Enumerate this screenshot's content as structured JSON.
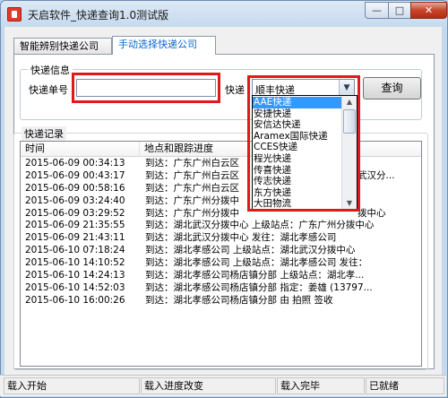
{
  "window": {
    "title": "天启软件_快递查询1.0测试版",
    "controls": {
      "minimize": "—",
      "maximize": "□",
      "close": "✕"
    }
  },
  "tabs": [
    {
      "label": "智能辨别快递公司"
    },
    {
      "label": "手动选择快递公司"
    }
  ],
  "query_group": {
    "title": "快递信息",
    "tracking_label": "快递单号",
    "tracking_value": "",
    "courier_label": "快递",
    "courier_selected": "顺丰快递",
    "query_button": "查询",
    "courier_options": [
      "AAE快递",
      "安捷快递",
      "安信达快递",
      "Aramex国际快递",
      "CCES快递",
      "程光快递",
      "传喜快递",
      "传志快递",
      "东方快递",
      "大田物流"
    ],
    "selected_option_index": 0
  },
  "records": {
    "title": "快递记录",
    "columns": [
      "时间",
      "地点和跟踪进度"
    ],
    "rows": [
      {
        "time": "2015-06-09 00:34:13",
        "status": "到达：广东广州白云区"
      },
      {
        "time": "2015-06-09 00:43:17",
        "status": "到达：广东广州白云区",
        "status_tail": "武汉分..."
      },
      {
        "time": "2015-06-09 00:58:16",
        "status": "到达：广东广州白云区"
      },
      {
        "time": "2015-06-09 03:24:40",
        "status": "到达：广东广州分拨中"
      },
      {
        "time": "2015-06-09 03:29:52",
        "status": "到达：广东广州分拨中",
        "status_tail": "拨中心"
      },
      {
        "time": "2015-06-09 21:35:55",
        "status": "到达：湖北武汉分拨中心 上级站点：广东广州分拨中心"
      },
      {
        "time": "2015-06-09 21:43:11",
        "status": "到达：湖北武汉分拨中心 发往：湖北孝感公司"
      },
      {
        "time": "2015-06-10 07:18:24",
        "status": "到达：湖北孝感公司 上级站点：湖北武汉分拨中心"
      },
      {
        "time": "2015-06-10 14:10:52",
        "status": "到达：湖北孝感公司 上级站点：湖北孝感公司 发往："
      },
      {
        "time": "2015-06-10 14:24:13",
        "status": "到达：湖北孝感公司杨店镇分部 上级站点：湖北孝..."
      },
      {
        "time": "2015-06-10 14:52:03",
        "status": "到达：湖北孝感公司杨店镇分部 指定：姜雄 (13797..."
      },
      {
        "time": "2015-06-10 16:00:26",
        "status": "到达：湖北孝感公司杨店镇分部 由 拍照 签收"
      }
    ]
  },
  "statusbar": [
    "载入开始",
    "载入进度改变",
    "载入完毕",
    "已就绪"
  ]
}
